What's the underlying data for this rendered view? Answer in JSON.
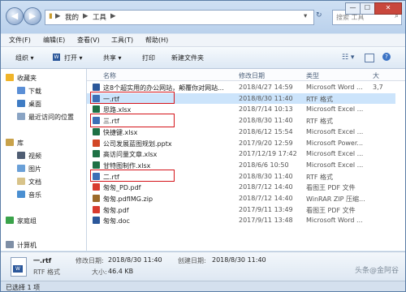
{
  "window": {
    "minimize": "—",
    "maximize": "☐",
    "close": "✕"
  },
  "address": {
    "seg1": "我的",
    "seg2": "工具",
    "sep": "▶"
  },
  "search": {
    "placeholder": "搜索 工具"
  },
  "menu": [
    "文件(F)",
    "编辑(E)",
    "查看(V)",
    "工具(T)",
    "帮助(H)"
  ],
  "toolbar": {
    "organize": "组织 ▾",
    "open": "打开 ▾",
    "share": "共享 ▾",
    "print": "打印",
    "new_folder": "新建文件夹"
  },
  "nav": {
    "favorites": "收藏夹",
    "downloads": "下载",
    "desktop": "桌面",
    "recent": "最近访问的位置",
    "libraries": "库",
    "videos": "视频",
    "pictures": "图片",
    "documents": "文档",
    "music": "音乐",
    "homegroup": "家庭组",
    "computer": "计算机"
  },
  "columns": {
    "name": "名称",
    "date": "修改日期",
    "type": "类型",
    "size": "大"
  },
  "files": [
    {
      "name": "这8个超实用的办公网站，颠覆你对网站...",
      "date": "2018/4/27 14:59",
      "type": "Microsoft Word ...",
      "size": "3,7",
      "icon": "word",
      "selected": false
    },
    {
      "name": "一.rtf",
      "date": "2018/8/30 11:40",
      "type": "RTF 格式",
      "size": "",
      "icon": "rtf",
      "selected": true
    },
    {
      "name": "思路.xlsx",
      "date": "2018/7/14 10:13",
      "type": "Microsoft Excel ...",
      "size": "",
      "icon": "excel",
      "selected": false
    },
    {
      "name": "三.rtf",
      "date": "2018/8/30 11:40",
      "type": "RTF 格式",
      "size": "",
      "icon": "rtf",
      "selected": false
    },
    {
      "name": "快捷键.xlsx",
      "date": "2018/6/12 15:54",
      "type": "Microsoft Excel ...",
      "size": "",
      "icon": "excel",
      "selected": false
    },
    {
      "name": "公司发展蓝图规划.pptx",
      "date": "2017/9/20 12:59",
      "type": "Microsoft Power...",
      "size": "",
      "icon": "ppt",
      "selected": false
    },
    {
      "name": "高访问量文章.xlsx",
      "date": "2017/12/19 17:42",
      "type": "Microsoft Excel ...",
      "size": "",
      "icon": "excel",
      "selected": false
    },
    {
      "name": "甘特图制作.xlsx",
      "date": "2018/6/6 10:50",
      "type": "Microsoft Excel ...",
      "size": "",
      "icon": "excel",
      "selected": false
    },
    {
      "name": "二.rtf",
      "date": "2018/8/30 11:40",
      "type": "RTF 格式",
      "size": "",
      "icon": "rtf",
      "selected": false
    },
    {
      "name": "匆匆_PD.pdf",
      "date": "2018/7/12 14:40",
      "type": "看图王 PDF 文件",
      "size": "",
      "icon": "pdf",
      "selected": false
    },
    {
      "name": "匆匆.pdfIMG.zip",
      "date": "2018/7/12 14:40",
      "type": "WinRAR ZIP 压缩...",
      "size": "",
      "icon": "zip",
      "selected": false
    },
    {
      "name": "匆匆.pdf",
      "date": "2017/9/11 13:49",
      "type": "看图王 PDF 文件",
      "size": "",
      "icon": "pdf",
      "selected": false
    },
    {
      "name": "匆匆.doc",
      "date": "2017/9/11 13:48",
      "type": "Microsoft Word ...",
      "size": "",
      "icon": "word",
      "selected": false
    }
  ],
  "details": {
    "filename": "一.rtf",
    "modified_label": "修改日期:",
    "modified": "2018/8/30 11:40",
    "created_label": "创建日期:",
    "created": "2018/8/30 11:40",
    "type": "RTF 格式",
    "size_label": "大小:",
    "size": "46.4 KB"
  },
  "status": "已选择 1 项",
  "watermark": "头条@金阿谷",
  "colors": {
    "word": "#2b579a",
    "excel": "#1e7145",
    "ppt": "#d24726",
    "pdf": "#d83b2f",
    "zip": "#9c6a2a",
    "rtf": "#3c6fb6",
    "highlight": "#d4141a"
  }
}
